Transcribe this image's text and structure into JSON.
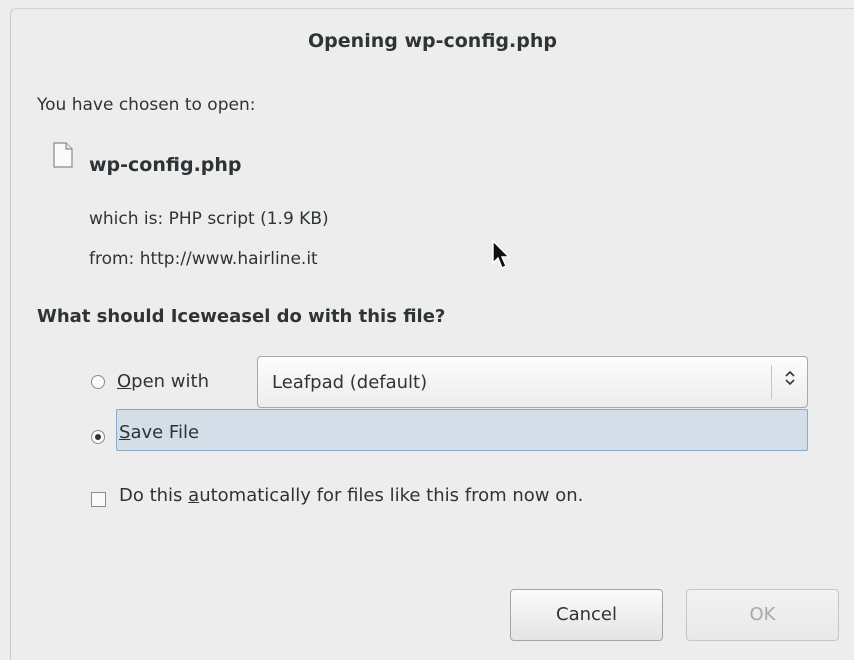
{
  "window": {
    "title": "Opening wp-config.php"
  },
  "file_info": {
    "intro": "You have chosen to open:",
    "icon": "document-icon",
    "filename": "wp-config.php",
    "which_is": "which is:  PHP script (1.9 KB)",
    "from": "from:  http://www.hairline.it"
  },
  "question": "What should Iceweasel do with this file?",
  "options": {
    "open_with": {
      "label_mnemonic": "O",
      "label_rest": "pen with",
      "checked": false,
      "app": "Leafpad (default)"
    },
    "save_file": {
      "label_mnemonic": "S",
      "label_rest": "ave File",
      "checked": true
    },
    "auto": {
      "label_before": "Do this ",
      "label_mnemonic": "a",
      "label_after": "utomatically for files like this from now on.",
      "checked": false
    }
  },
  "buttons": {
    "cancel": "Cancel",
    "ok": "OK",
    "ok_enabled": false
  },
  "colors": {
    "dialog_bg": "#ededed",
    "selection_bg": "#d3dee8",
    "disabled_text": "#a9a9a9"
  }
}
